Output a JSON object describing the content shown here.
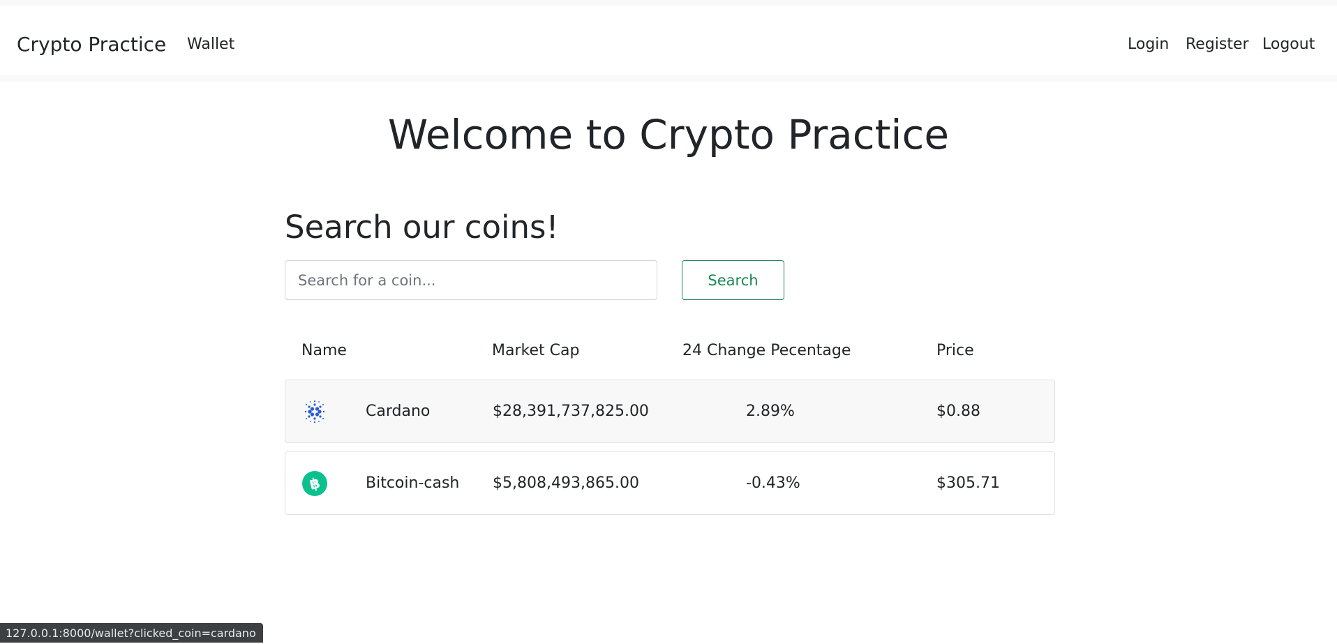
{
  "navbar": {
    "brand": "Crypto Practice",
    "links": {
      "wallet": "Wallet",
      "login": "Login",
      "register": "Register",
      "logout": "Logout"
    }
  },
  "page": {
    "welcome": "Welcome to Crypto Practice",
    "search_heading": "Search our coins!"
  },
  "search": {
    "placeholder": "Search for a coin...",
    "value": "",
    "button_label": "Search"
  },
  "table": {
    "headers": {
      "name": "Name",
      "market_cap": "Market Cap",
      "change": "24 Change Pecentage",
      "price": "Price"
    },
    "rows": [
      {
        "icon": "cardano-icon",
        "name": "Cardano",
        "market_cap": "$28,391,737,825.00",
        "change": "2.89%",
        "price": "$0.88",
        "highlighted": true
      },
      {
        "icon": "bitcoin-cash-icon",
        "name": "Bitcoin-cash",
        "market_cap": "$5,808,493,865.00",
        "change": "-0.43%",
        "price": "$305.71",
        "highlighted": false
      }
    ]
  },
  "status_bar": {
    "url": "127.0.0.1:8000/wallet?clicked_coin=cardano"
  },
  "colors": {
    "accent_green": "#198754",
    "text": "#212529",
    "cardano_blue": "#2a5bd7",
    "bitcoin_cash_green": "#0ac18e"
  }
}
